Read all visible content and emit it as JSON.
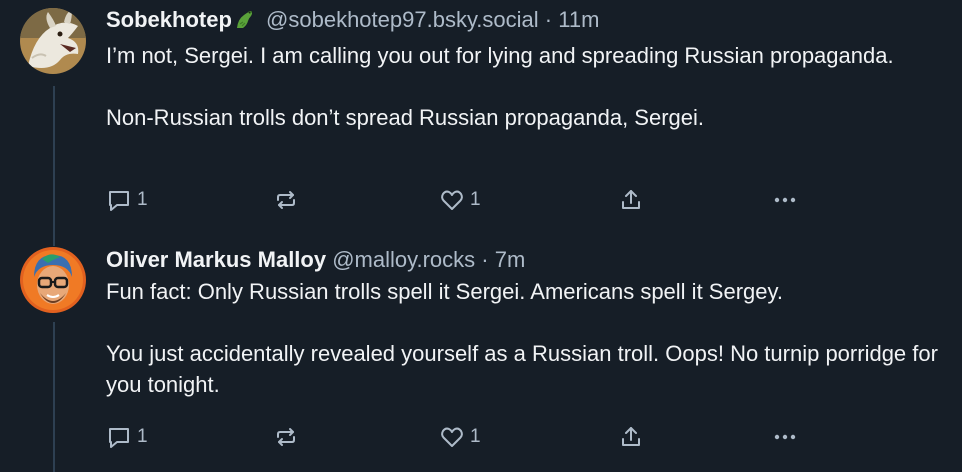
{
  "posts": [
    {
      "author": "Sobekhotep",
      "handle": "@sobekhotep97.bsky.social",
      "separator": "·",
      "time": "11m",
      "paragraphs": [
        "I’m not, Sergei. I am calling you out for lying and spreading Russian propaganda.",
        "Non-Russian trolls don’t spread Russian propaganda, Sergei."
      ],
      "reply_count": "1",
      "like_count": "1",
      "author_emoji": "crocodile-emoji"
    },
    {
      "author": "Oliver Markus Malloy",
      "handle": "@malloy.rocks",
      "separator": "·",
      "time": "7m",
      "paragraphs": [
        "Fun fact: Only Russian trolls spell it Sergei. Americans spell it Sergey.",
        "You just accidentally revealed yourself as a Russian troll. Oops! No turnip porridge for you tonight."
      ],
      "reply_count": "1",
      "like_count": "1"
    }
  ],
  "icons": {
    "reply": "reply-bubble-icon",
    "repost": "repost-icon",
    "like": "heart-icon",
    "share": "share-icon",
    "more": "more-options-icon"
  },
  "colors": {
    "background": "#161e27",
    "text": "#f1f3f5",
    "muted": "#aebbc9",
    "thread_line": "#2e4052"
  }
}
